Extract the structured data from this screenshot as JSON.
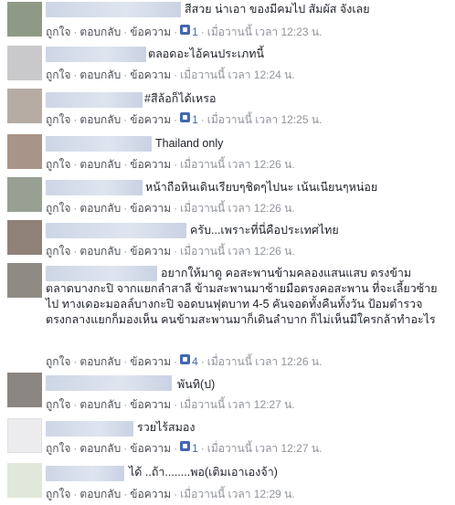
{
  "actions": {
    "like": "ถูกใจ",
    "reply": "ตอบกลับ",
    "message": "ข้อความ",
    "sep": "·"
  },
  "colors": {
    "link": "#4b4f56",
    "meta": "#90949c",
    "like_blue": "#4267b2"
  },
  "comments": [
    {
      "text": "สีสวย น่าเอา ของมีคมไป สัมผัส จังเลย",
      "likes": "1",
      "time": "เมื่อวานนี้ เวลา 12:23 น."
    },
    {
      "text": "ตลอดอะไอ้คนประเภทนี้",
      "likes": "",
      "time": "เมื่อวานนี้ เวลา 12:24 น."
    },
    {
      "text": "#สีล้อก็ได้เหรอ",
      "likes": "1",
      "time": "เมื่อวานนี้ เวลา 12:25 น."
    },
    {
      "text": "Thailand only",
      "likes": "",
      "time": "เมื่อวานนี้ เวลา 12:26 น."
    },
    {
      "text": "หน้าถือหินเดินเรียบๆชิดๆไปนะ เน้นเนียนๆหน่อย",
      "likes": "",
      "time": "เมื่อวานนี้ เวลา 12:26 น."
    },
    {
      "text": "ครับ...เพราะที่นี่คือประเทศไทย",
      "likes": "",
      "time": "เมื่อวานนี้ เวลา 12:26 น."
    },
    {
      "text": "อยากให้มาดู คอสะพานข้ามคลองแสนแสบ ตรงข้ามตลาดบางกะปิ จากแยกลำสาลี ข้ามสะพานมาซ้ายมือตรงคอสะพาน ที่จะเลี้ยวซ้ายไป ทางเดอะมอลล์บางกะปิ จอดบนฟุตบาท 4-5 คันจอดทั้งคืนทั้งวัน ป้อมตำรวจตรงกลางแยกก็มองเห็น คนข้ามสะพานมาก็เดินลำบาก ก็ไม่เห็นมีใครกล้าทำอะไร",
      "likes": "4",
      "time": "เมื่อวานนี้ เวลา 12:26 น."
    },
    {
      "text": "พันทิ(ป)",
      "likes": "",
      "time": "เมื่อวานนี้ เวลา 12:27 น."
    },
    {
      "text": "รวยไร้สมอง",
      "likes": "1",
      "time": "เมื่อวานนี้ เวลา 12:27 น."
    },
    {
      "text": "ได้ ..ถ้า........พอ(เติมเอาเองจ้า)",
      "likes": "",
      "time": "เมื่อวานนี้ เวลา 12:29 น."
    }
  ]
}
